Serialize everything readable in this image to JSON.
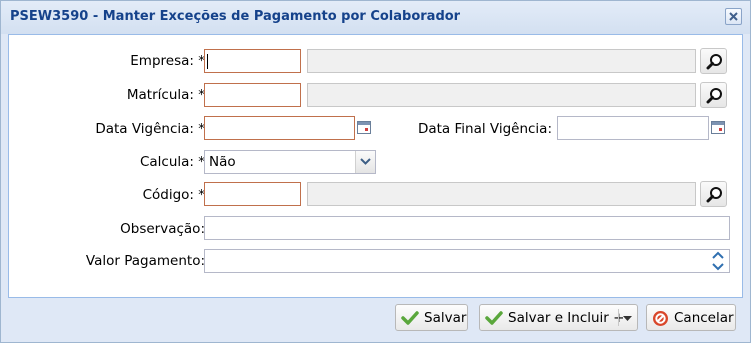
{
  "window": {
    "title": "PSEW3590 - Manter Exceções de Pagamento por Colaborador"
  },
  "form": {
    "empresa": {
      "label": "Empresa: *",
      "value": "",
      "description": ""
    },
    "matricula": {
      "label": "Matrícula: *",
      "value": "",
      "description": ""
    },
    "data_vigencia": {
      "label": "Data Vigência: *",
      "value": ""
    },
    "data_final_vigencia": {
      "label": "Data Final Vigência:",
      "value": ""
    },
    "calcula": {
      "label": "Calcula: *",
      "selected": "Não"
    },
    "codigo": {
      "label": "Código: *",
      "value": "",
      "description": ""
    },
    "observacao": {
      "label": "Observação:",
      "value": ""
    },
    "valor_pagamento": {
      "label": "Valor Pagamento:",
      "value": ""
    }
  },
  "footer": {
    "save_label": "Salvar",
    "save_include_label": "Salvar e Incluir +",
    "cancel_label": "Cancelar"
  },
  "icons": {
    "close": "close-icon",
    "lookup": "magnifier-icon",
    "calendar": "calendar-icon",
    "dropdown": "chevron-down-icon",
    "spinner": "spinner-icon",
    "save": "check-icon",
    "cancel": "cancel-icon"
  },
  "colors": {
    "title_text": "#15428b",
    "required_border": "#c0704c",
    "save_icon": "#5aa73c",
    "cancel_icon": "#d9472b"
  }
}
